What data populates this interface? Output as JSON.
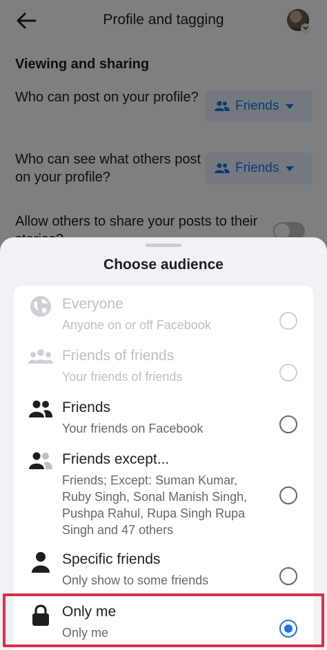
{
  "header": {
    "title": "Profile and tagging",
    "back_icon": "arrow-left-icon",
    "avatar_icon": "profile-avatar"
  },
  "settings": {
    "section_heading": "Viewing and sharing",
    "post_on_profile": {
      "label": "Who can post on your profile?",
      "value": "Friends"
    },
    "see_others_posts": {
      "label": "Who can see what others post on your profile?",
      "value": "Friends"
    },
    "share_to_stories": {
      "label": "Allow others to share your posts to their stories?",
      "enabled": false
    }
  },
  "sheet": {
    "title": "Choose audience",
    "options": [
      {
        "title": "Everyone",
        "subtitle": "Anyone on or off Facebook",
        "icon": "globe-icon",
        "disabled": true,
        "selected": false
      },
      {
        "title": "Friends of friends",
        "subtitle": "Your friends of friends",
        "icon": "people-group-icon",
        "disabled": true,
        "selected": false
      },
      {
        "title": "Friends",
        "subtitle": "Your friends on Facebook",
        "icon": "friends-icon",
        "disabled": false,
        "selected": false
      },
      {
        "title": "Friends except...",
        "subtitle": "Friends; Except: Suman Kumar, Ruby Singh, Sonal Manish Singh, Pushpa Rahul, Rupa Singh Rupa Singh and 47 others",
        "icon": "friends-except-icon",
        "disabled": false,
        "selected": false
      },
      {
        "title": "Specific friends",
        "subtitle": "Only show to some friends",
        "icon": "person-icon",
        "disabled": false,
        "selected": false
      },
      {
        "title": "Only me",
        "subtitle": "Only me",
        "icon": "lock-icon",
        "disabled": false,
        "selected": true
      }
    ]
  },
  "colors": {
    "accent": "#1b74e4",
    "highlight_border": "#d9304a",
    "disabled_text": "#bcc0c4",
    "secondary_text": "#65676b"
  }
}
